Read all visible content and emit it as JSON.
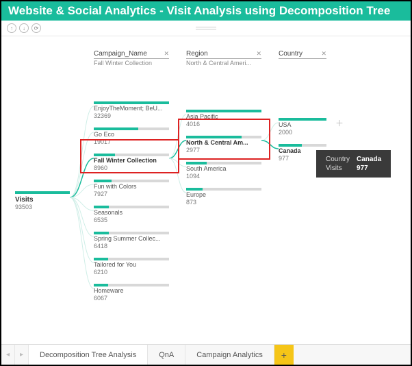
{
  "title": "Website & Social Analytics - Visit Analysis using Decomposition Tree",
  "columns": {
    "campaign": {
      "label": "Campaign_Name",
      "sub": "Fall Winter Collection"
    },
    "region": {
      "label": "Region",
      "sub": "North & Central Ameri..."
    },
    "country": {
      "label": "Country",
      "sub": ""
    }
  },
  "root": {
    "label": "Visits",
    "value": "93503"
  },
  "campaigns": [
    {
      "label": "EnjoyTheMoment; BeU...",
      "value": "32369",
      "fill": 100
    },
    {
      "label": "Go Eco",
      "value": "19017",
      "fill": 59
    },
    {
      "label": "Fall Winter Collection",
      "value": "8960",
      "fill": 28,
      "selected": true
    },
    {
      "label": "Fun with Colors",
      "value": "7927",
      "fill": 24
    },
    {
      "label": "Seasonals",
      "value": "6535",
      "fill": 20
    },
    {
      "label": "Spring Summer Collec...",
      "value": "6418",
      "fill": 20
    },
    {
      "label": "Tailored for You",
      "value": "6210",
      "fill": 19
    },
    {
      "label": "Homeware",
      "value": "6067",
      "fill": 19
    }
  ],
  "regions": [
    {
      "label": "Asia Pacific",
      "value": "4016",
      "fill": 100
    },
    {
      "label": "North & Central Am...",
      "value": "2977",
      "fill": 74,
      "selected": true
    },
    {
      "label": "South America",
      "value": "1094",
      "fill": 27
    },
    {
      "label": "Europe",
      "value": "873",
      "fill": 22
    }
  ],
  "countries": [
    {
      "label": "USA",
      "value": "2000",
      "fill": 100
    },
    {
      "label": "Canada",
      "value": "977",
      "fill": 49,
      "selected": true
    }
  ],
  "tooltip": {
    "k1": "Country",
    "v1": "Canada",
    "k2": "Visits",
    "v2": "977"
  },
  "tabs": {
    "t1": "Decomposition Tree Analysis",
    "t2": "QnA",
    "t3": "Campaign Analytics"
  },
  "chart_data": {
    "type": "bar",
    "title": "Website & Social Analytics - Visit Analysis using Decomposition Tree",
    "root_measure": "Visits",
    "root_value": 93503,
    "levels": [
      {
        "name": "Campaign_Name",
        "selected": "Fall Winter Collection",
        "items": [
          {
            "name": "EnjoyTheMoment; BeU...",
            "value": 32369
          },
          {
            "name": "Go Eco",
            "value": 19017
          },
          {
            "name": "Fall Winter Collection",
            "value": 8960
          },
          {
            "name": "Fun with Colors",
            "value": 7927
          },
          {
            "name": "Seasonals",
            "value": 6535
          },
          {
            "name": "Spring Summer Collection",
            "value": 6418
          },
          {
            "name": "Tailored for You",
            "value": 6210
          },
          {
            "name": "Homeware",
            "value": 6067
          }
        ]
      },
      {
        "name": "Region",
        "selected": "North & Central America",
        "items": [
          {
            "name": "Asia Pacific",
            "value": 4016
          },
          {
            "name": "North & Central America",
            "value": 2977
          },
          {
            "name": "South America",
            "value": 1094
          },
          {
            "name": "Europe",
            "value": 873
          }
        ]
      },
      {
        "name": "Country",
        "selected": "Canada",
        "items": [
          {
            "name": "USA",
            "value": 2000
          },
          {
            "name": "Canada",
            "value": 977
          }
        ]
      }
    ]
  }
}
